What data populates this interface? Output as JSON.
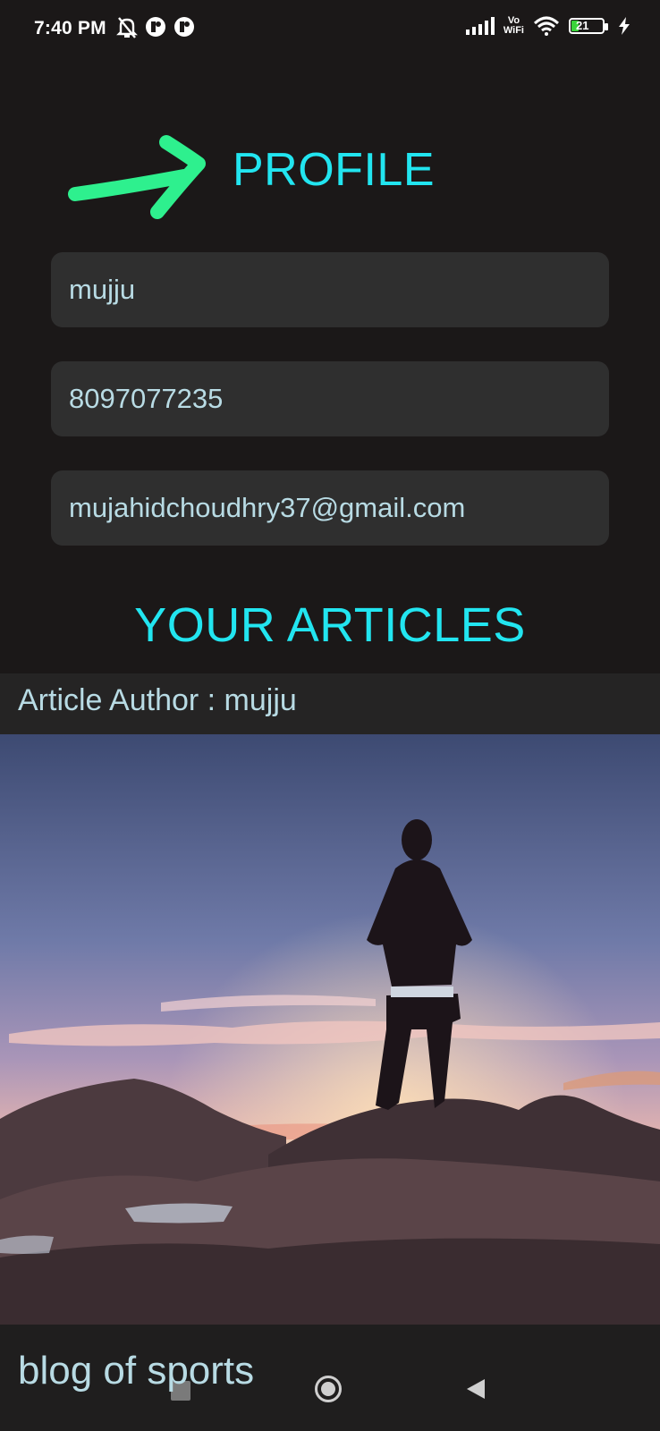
{
  "status_bar": {
    "time": "7:40 PM",
    "vowifi_top": "Vo",
    "vowifi_bottom": "WiFi",
    "battery_level": "21",
    "icons": [
      "mute-bell-icon",
      "app-notification-icon",
      "app-notification-icon",
      "signal-icon",
      "wifi-icon",
      "battery-icon",
      "charging-bolt-icon"
    ]
  },
  "profile": {
    "title": "PROFILE",
    "name": "mujju",
    "phone": "8097077235",
    "email": "mujahidchoudhry37@gmail.com"
  },
  "articles": {
    "title": "YOUR ARTICLES",
    "items": [
      {
        "author_line": "Article Author : mujju",
        "image": "hiker-silhouette-mountain-sunset",
        "title": "blog of sports"
      }
    ]
  },
  "nav_bar": {
    "buttons": [
      "recents-square-icon",
      "home-circle-icon",
      "back-triangle-icon"
    ]
  },
  "colors": {
    "background": "#1b1818",
    "accent": "#22e5f0",
    "field_bg": "#2f2f2f",
    "field_text": "#b8dbe4",
    "annotation_arrow": "#2ef08e"
  }
}
